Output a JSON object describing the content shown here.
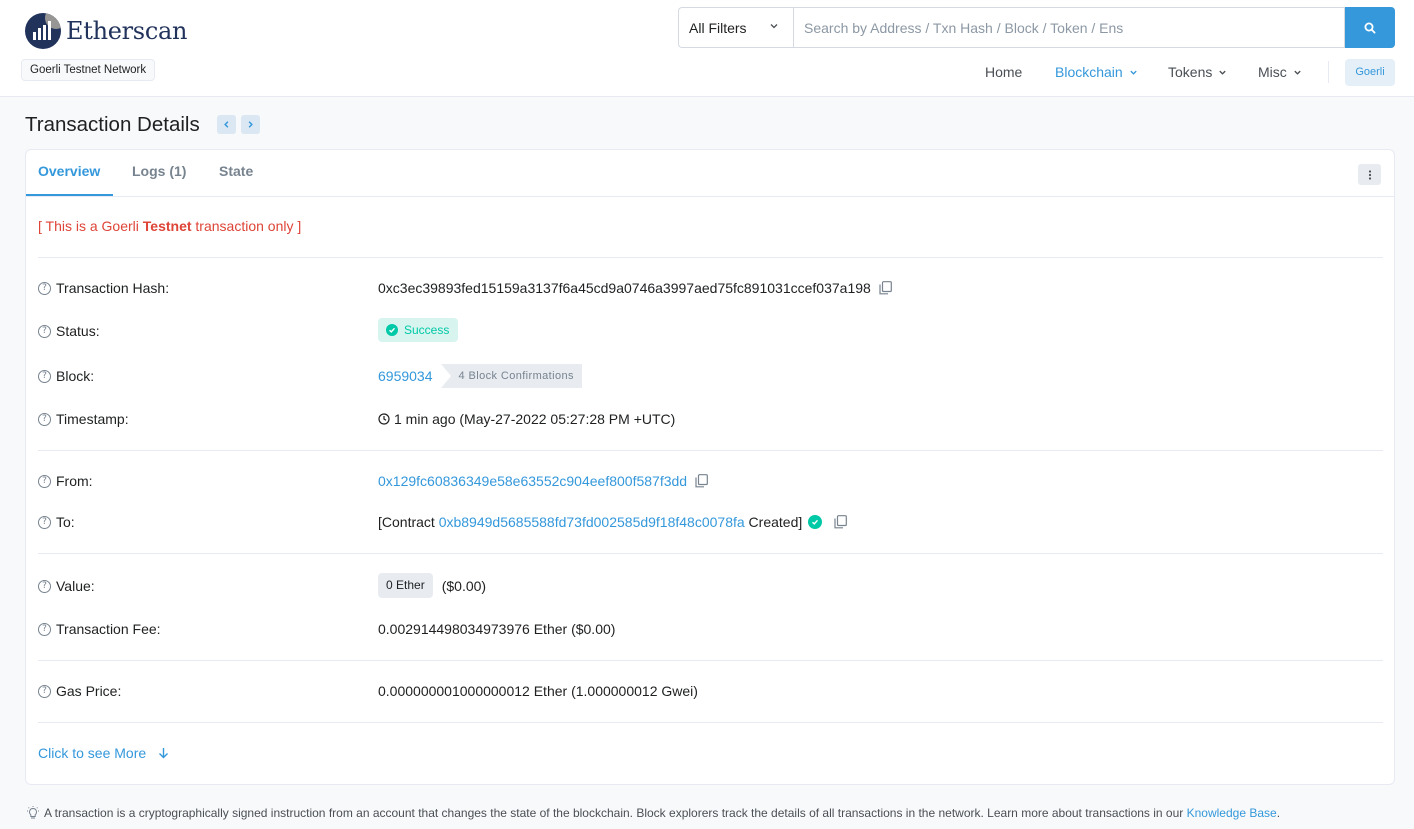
{
  "header": {
    "logo_text": "Etherscan",
    "network": "Goerli Testnet Network",
    "search": {
      "filter": "All Filters",
      "placeholder": "Search by Address / Txn Hash / Block / Token / Ens"
    },
    "nav": {
      "home": "Home",
      "blockchain": "Blockchain",
      "tokens": "Tokens",
      "misc": "Misc",
      "network_button": "Goerli"
    }
  },
  "page": {
    "title": "Transaction Details"
  },
  "tabs": {
    "overview": "Overview",
    "logs": "Logs (1)",
    "state": "State"
  },
  "testnet_note": {
    "prefix": "[ This is a Goerli ",
    "bold": "Testnet",
    "suffix": " transaction only ]"
  },
  "details": {
    "tx_hash": {
      "label": "Transaction Hash:",
      "value": "0xc3ec39893fed15159a3137f6a45cd9a0746a3997aed75fc891031ccef037a198"
    },
    "status": {
      "label": "Status:",
      "value": "Success"
    },
    "block": {
      "label": "Block:",
      "value": "6959034",
      "confirmations": "4 Block Confirmations"
    },
    "timestamp": {
      "label": "Timestamp:",
      "value": "1 min ago (May-27-2022 05:27:28 PM +UTC)"
    },
    "from": {
      "label": "From:",
      "value": "0x129fc60836349e58e63552c904eef800f587f3dd"
    },
    "to": {
      "label": "To:",
      "prefix": "[Contract ",
      "address": "0xb8949d5685588fd73fd002585d9f18f48c0078fa",
      "suffix": " Created]"
    },
    "value": {
      "label": "Value:",
      "amount": "0 Ether",
      "usd": "($0.00)"
    },
    "fee": {
      "label": "Transaction Fee:",
      "value": "0.002914498034973976 Ether ($0.00)"
    },
    "gas_price": {
      "label": "Gas Price:",
      "value": "0.000000001000000012 Ether (1.000000012 Gwei)"
    }
  },
  "see_more": "Click to see More",
  "footer": {
    "text": "A transaction is a cryptographically signed instruction from an account that changes the state of the blockchain. Block explorers track the details of all transactions in the network. Learn more about transactions in our ",
    "link": "Knowledge Base",
    "end": "."
  },
  "colors": {
    "accent": "#3498db",
    "success": "#00c9a7",
    "danger": "#de4437",
    "brand": "#21325b"
  }
}
